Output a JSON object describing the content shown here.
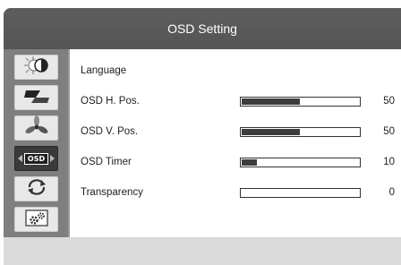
{
  "title": "OSD Setting",
  "sidebar": {
    "items": [
      {
        "icon": "brightness-contrast-icon"
      },
      {
        "icon": "image-position-icon"
      },
      {
        "icon": "color-fan-icon"
      },
      {
        "icon": "osd-icon",
        "label": "OSD",
        "active": true
      },
      {
        "icon": "reset-arrows-icon"
      },
      {
        "icon": "settings-gears-icon"
      }
    ]
  },
  "rows": [
    {
      "label": "Language",
      "value": "",
      "level": null
    },
    {
      "label": "OSD H. Pos.",
      "value": "50",
      "level": 0.5
    },
    {
      "label": "OSD V. Pos.",
      "value": "50",
      "level": 0.5
    },
    {
      "label": "OSD Timer",
      "value": "10",
      "level": 0.13
    },
    {
      "label": "Transparency",
      "value": "0",
      "level": 0
    }
  ],
  "colors": {
    "frame": "#5a5a5a",
    "sidebar": "#7f7f7f",
    "bar_fill": "#3d3d3d",
    "active_item": "#3a3a3a"
  }
}
